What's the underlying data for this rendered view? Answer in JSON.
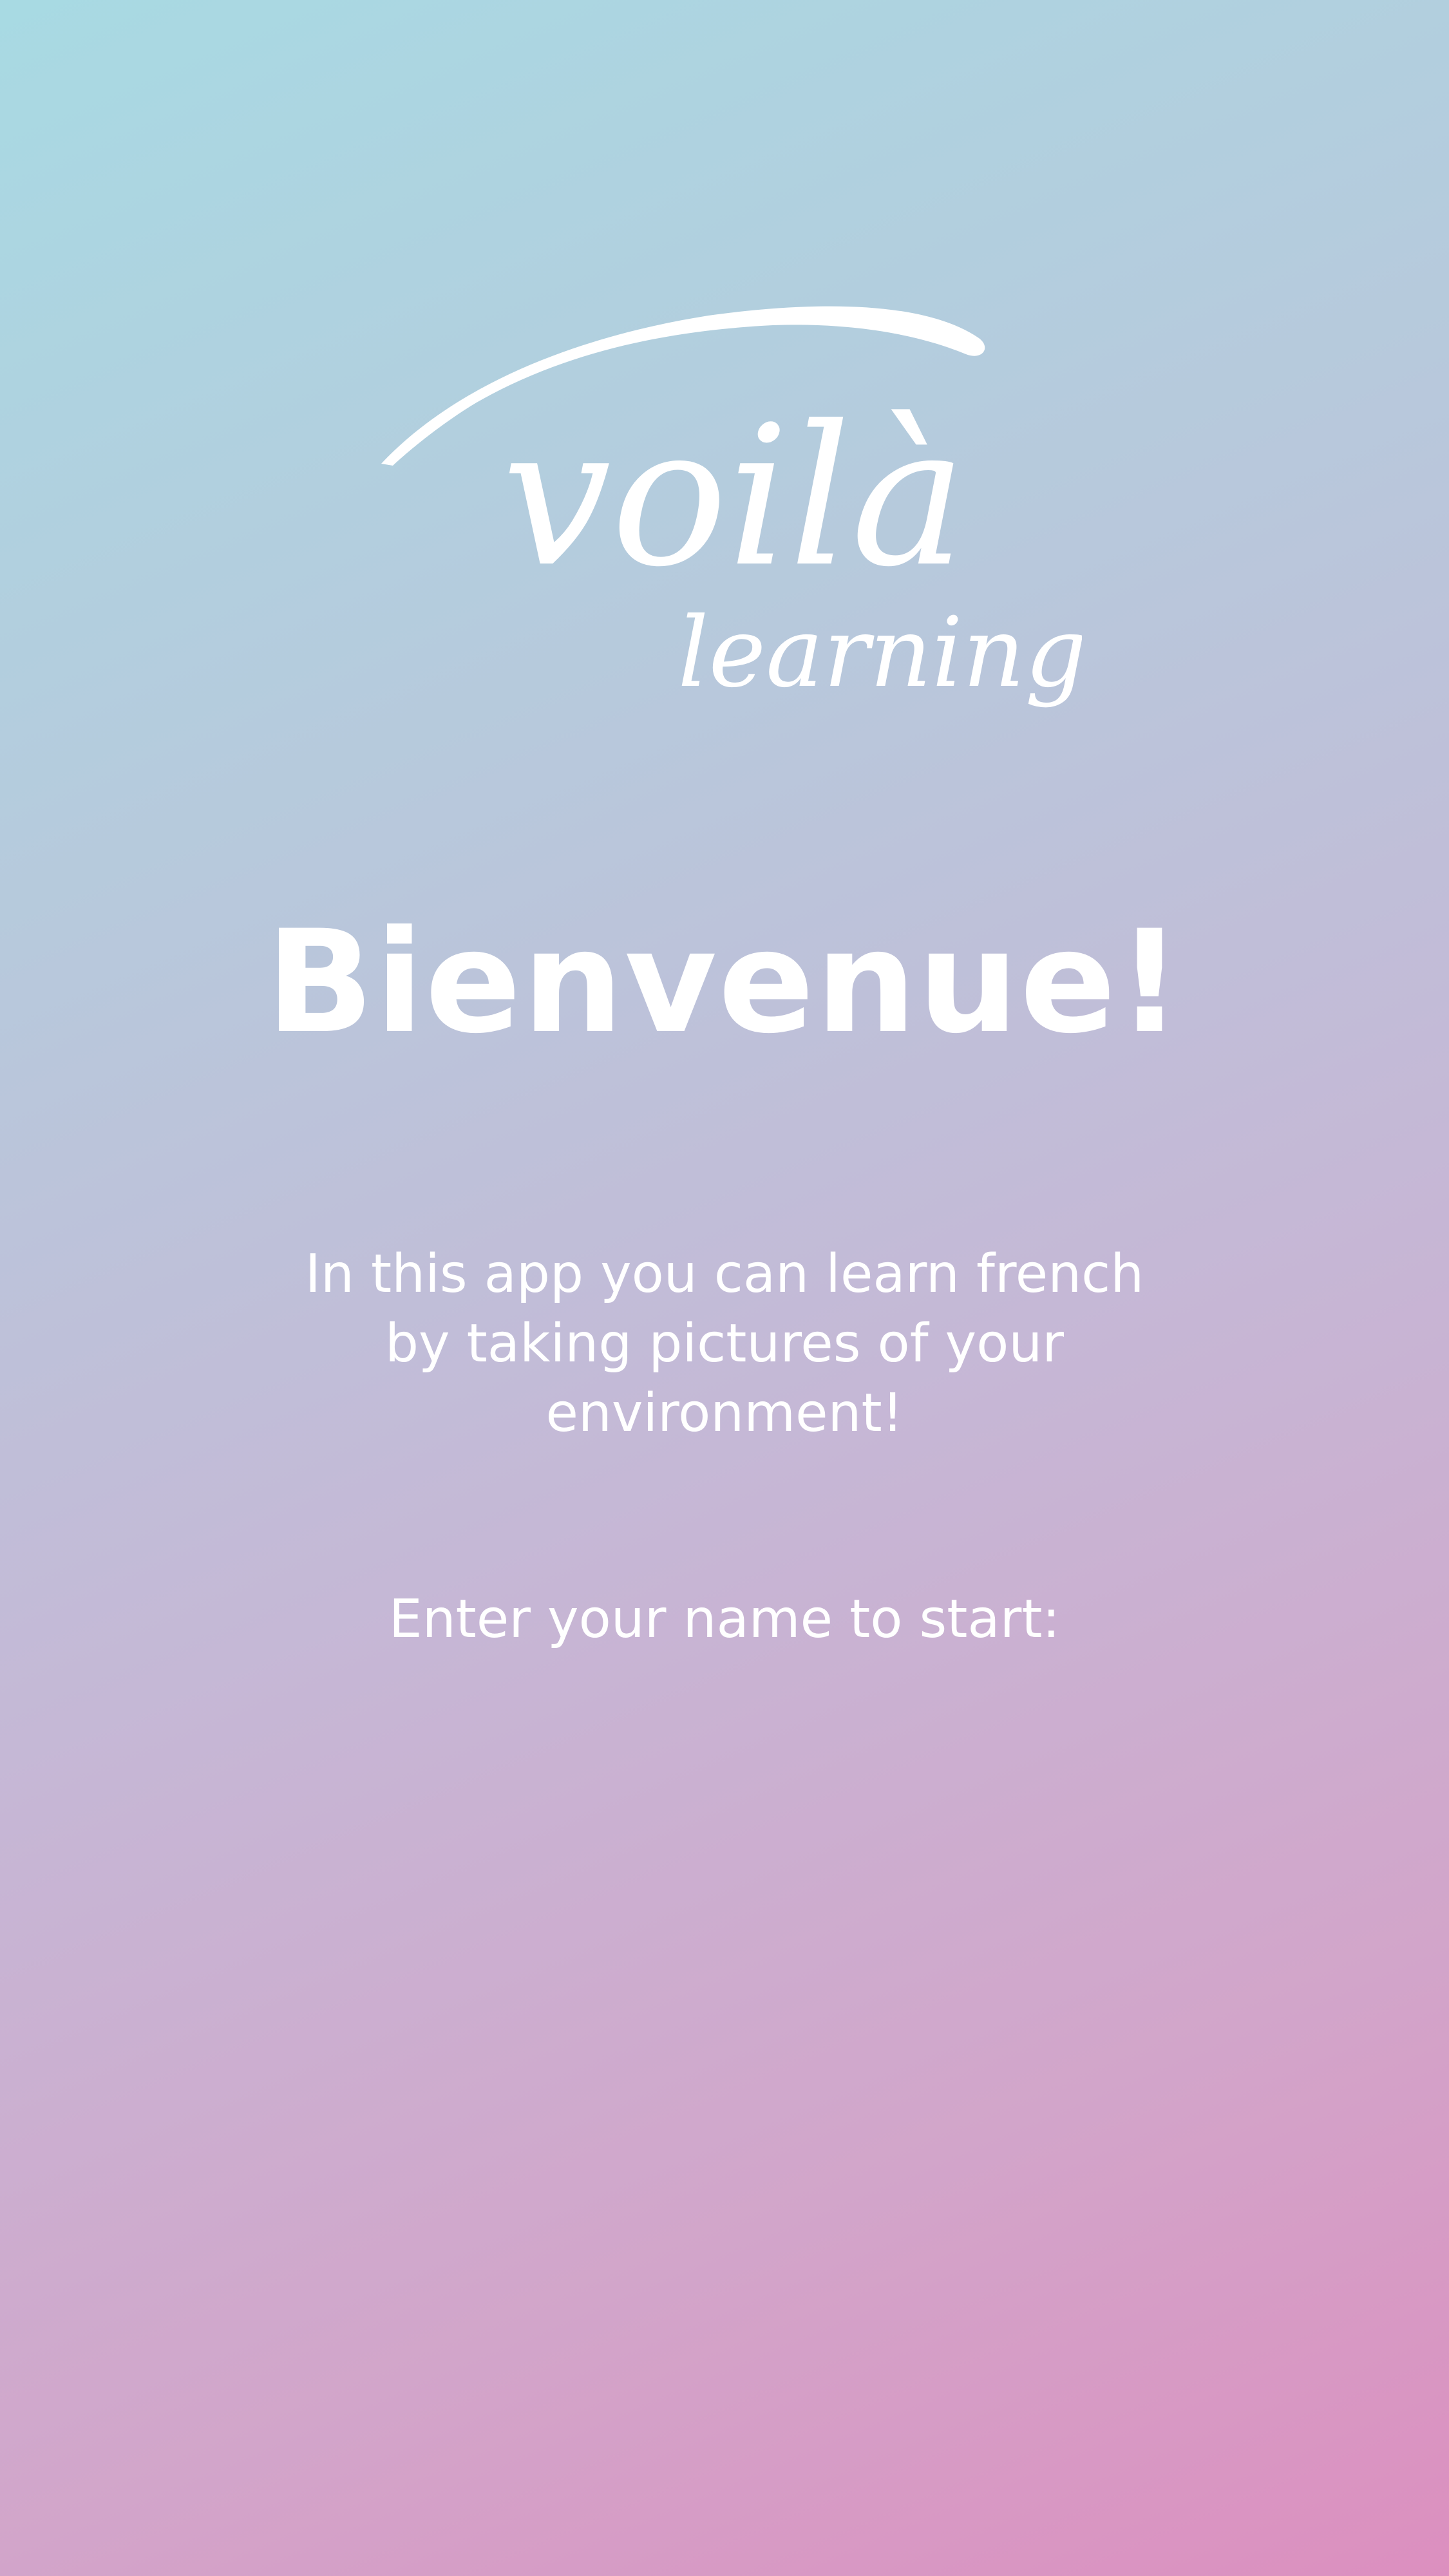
{
  "app": {
    "logo_word": "voilà",
    "logo_subtitle": "learning"
  },
  "welcome": {
    "title": "Bienvenue!",
    "intro": "In this app you can learn french by taking pictures of your environment!",
    "prompt": "Enter your name to start:"
  },
  "name_input": {
    "value": "",
    "placeholder": ""
  },
  "colors": {
    "gradient_top_right": "#a8dae3",
    "gradient_bottom_left": "#dc8fbf",
    "text": "#ffffff"
  }
}
